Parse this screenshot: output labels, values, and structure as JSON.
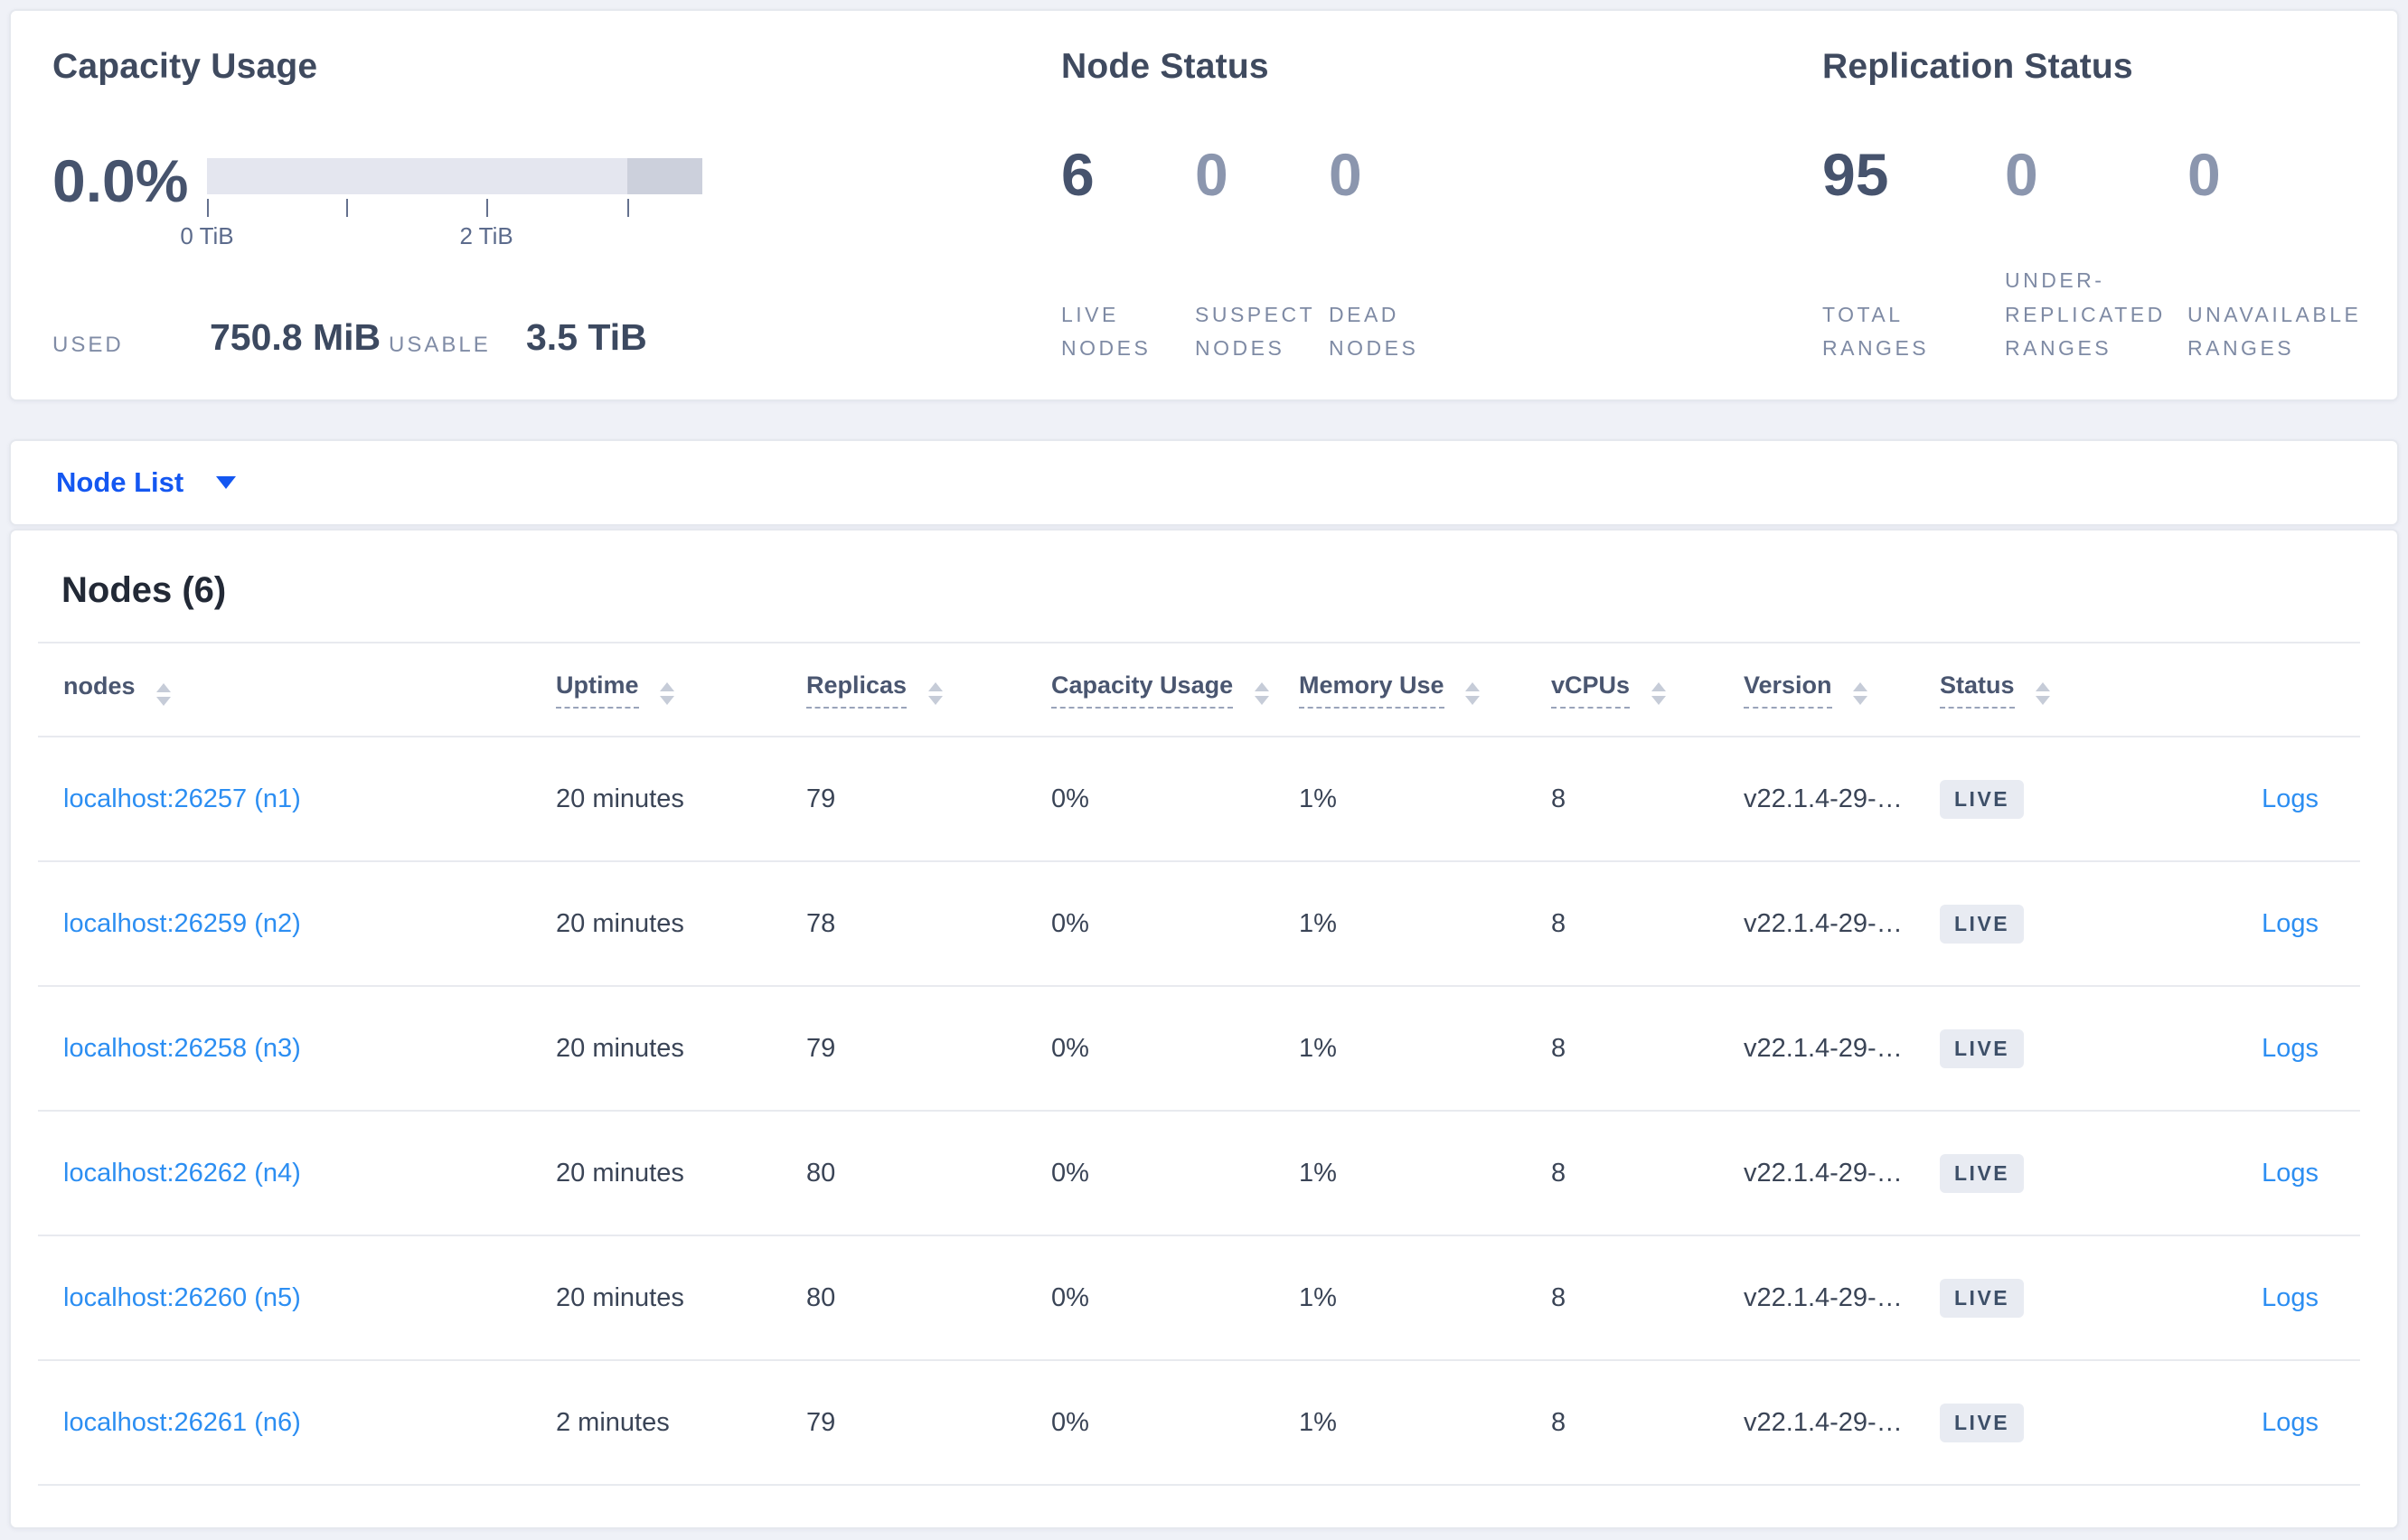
{
  "colors": {
    "accent_blue": "#1457f1",
    "link_blue": "#2c8ef2",
    "badge_bg": "#e8ebf2",
    "badge_text": "#3d4f68",
    "bar_track": "#e4e6ef",
    "bar_segment": "#ccd0dc",
    "page_bg": "#eff1f7"
  },
  "summary": {
    "capacity": {
      "title": "Capacity Usage",
      "percent": "0.0%",
      "used_label": "USED",
      "used_value": "750.8 MiB",
      "usable_label": "USABLE",
      "usable_value": "3.5 TiB",
      "bar": {
        "segment_start_pct": 84.9,
        "ticks": [
          {
            "pct": 0,
            "label": "0 TiB"
          },
          {
            "pct": 28.1,
            "label": ""
          },
          {
            "pct": 56.4,
            "label": "2 TiB"
          },
          {
            "pct": 84.9,
            "label": ""
          }
        ]
      }
    },
    "node_status": {
      "title": "Node Status",
      "stats": [
        {
          "value": "6",
          "label": "LIVE NODES"
        },
        {
          "value": "0",
          "label": "SUSPECT NODES"
        },
        {
          "value": "0",
          "label": "DEAD NODES"
        }
      ]
    },
    "replication_status": {
      "title": "Replication Status",
      "stats": [
        {
          "value": "95",
          "label": "TOTAL RANGES"
        },
        {
          "value": "0",
          "label": "UNDER-REPLICATED RANGES"
        },
        {
          "value": "0",
          "label": "UNAVAILABLE RANGES"
        }
      ]
    }
  },
  "node_list_bar": {
    "label": "Node List"
  },
  "table": {
    "title": "Nodes (6)",
    "columns": [
      {
        "label": "nodes",
        "sortable": false
      },
      {
        "label": "Uptime",
        "sortable": true
      },
      {
        "label": "Replicas",
        "sortable": true
      },
      {
        "label": "Capacity Usage",
        "sortable": true
      },
      {
        "label": "Memory Use",
        "sortable": true
      },
      {
        "label": "vCPUs",
        "sortable": true
      },
      {
        "label": "Version",
        "sortable": true
      },
      {
        "label": "Status",
        "sortable": true
      }
    ],
    "rows": [
      {
        "node": "localhost:26257 (n1)",
        "uptime": "20 minutes",
        "replicas": "79",
        "capacity": "0%",
        "memory": "1%",
        "vcpus": "8",
        "version": "v22.1.4-29-g…",
        "status": "LIVE",
        "logs": "Logs"
      },
      {
        "node": "localhost:26259 (n2)",
        "uptime": "20 minutes",
        "replicas": "78",
        "capacity": "0%",
        "memory": "1%",
        "vcpus": "8",
        "version": "v22.1.4-29-g…",
        "status": "LIVE",
        "logs": "Logs"
      },
      {
        "node": "localhost:26258 (n3)",
        "uptime": "20 minutes",
        "replicas": "79",
        "capacity": "0%",
        "memory": "1%",
        "vcpus": "8",
        "version": "v22.1.4-29-g…",
        "status": "LIVE",
        "logs": "Logs"
      },
      {
        "node": "localhost:26262 (n4)",
        "uptime": "20 minutes",
        "replicas": "80",
        "capacity": "0%",
        "memory": "1%",
        "vcpus": "8",
        "version": "v22.1.4-29-g…",
        "status": "LIVE",
        "logs": "Logs"
      },
      {
        "node": "localhost:26260 (n5)",
        "uptime": "20 minutes",
        "replicas": "80",
        "capacity": "0%",
        "memory": "1%",
        "vcpus": "8",
        "version": "v22.1.4-29-g…",
        "status": "LIVE",
        "logs": "Logs"
      },
      {
        "node": "localhost:26261 (n6)",
        "uptime": "2 minutes",
        "replicas": "79",
        "capacity": "0%",
        "memory": "1%",
        "vcpus": "8",
        "version": "v22.1.4-29-g…",
        "status": "LIVE",
        "logs": "Logs"
      }
    ]
  }
}
